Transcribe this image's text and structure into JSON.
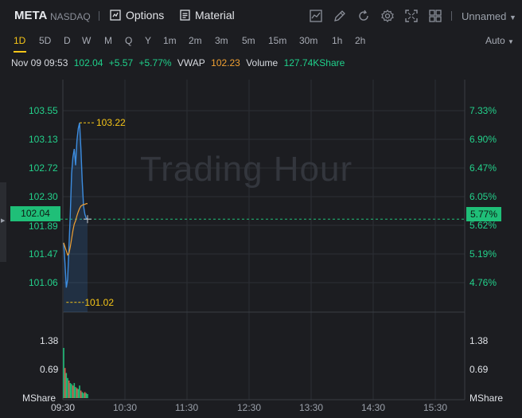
{
  "header": {
    "ticker": "META",
    "exchange": "NASDAQ",
    "options_label": "Options",
    "material_label": "Material",
    "layout_name": "Unnamed",
    "icons": [
      "indicator-icon",
      "draw-icon",
      "refresh-icon",
      "settings-icon",
      "fullscreen-icon",
      "layout-grid-icon"
    ]
  },
  "periods": [
    "1D",
    "5D",
    "D",
    "W",
    "M",
    "Q",
    "Y",
    "1m",
    "2m",
    "3m",
    "5m",
    "15m",
    "30m",
    "1h",
    "2h"
  ],
  "active_period": "1D",
  "auto_label": "Auto",
  "quote": {
    "datetime": "Nov 09 09:53",
    "price": "102.04",
    "change": "+5.57",
    "change_pct": "+5.77%",
    "vwap_label": "VWAP",
    "vwap": "102.23",
    "volume_label": "Volume",
    "volume": "127.74KShare"
  },
  "watermark": "Trading Hour",
  "current_price_tag": "102.04",
  "current_pct_tag": "5.77%",
  "high_label": "103.22",
  "low_label": "101.02",
  "volume_axis": {
    "left": [
      "1.38",
      "0.69",
      "MShare"
    ],
    "right": [
      "1.38",
      "0.69",
      "MShare"
    ]
  },
  "colors": {
    "up": "#1fd18b",
    "price_line": "#3d8de0",
    "vwap_line": "#f0a032",
    "highlight": "#f5c518",
    "background": "#1c1d21"
  },
  "chart_data": {
    "type": "line",
    "x_ticks": [
      "09:30",
      "10:30",
      "11:30",
      "12:30",
      "13:30",
      "14:30",
      "15:30"
    ],
    "y_left_ticks": [
      "103.55",
      "103.13",
      "102.72",
      "102.30",
      "101.89",
      "101.47",
      "101.06"
    ],
    "y_right_ticks": [
      "7.33%",
      "6.90%",
      "6.47%",
      "6.05%",
      "5.62%",
      "5.19%",
      "4.76%"
    ],
    "ylim": [
      100.9,
      103.75
    ],
    "series": [
      {
        "values": [
          101.75,
          101.5,
          101.2,
          101.3,
          101.7,
          102.1,
          102.6,
          102.8,
          102.9,
          102.7,
          103.0,
          103.15,
          103.22,
          102.9,
          102.5,
          102.2,
          102.1,
          102.05,
          102.04
        ]
      },
      {
        "values": [
          101.75,
          101.7,
          101.65,
          101.6,
          101.62,
          101.7,
          101.8,
          101.9,
          101.98,
          102.02,
          102.08,
          102.13,
          102.17,
          102.2,
          102.21,
          102.22,
          102.22,
          102.23,
          102.23
        ]
      }
    ],
    "volume": [
      1.0,
      0.6,
      0.5,
      0.4,
      0.35,
      0.3,
      0.28,
      0.25,
      0.3,
      0.22,
      0.2,
      0.18,
      0.25,
      0.15,
      0.12,
      0.1,
      0.12,
      0.1,
      0.08
    ],
    "volume_max": 1.65
  }
}
